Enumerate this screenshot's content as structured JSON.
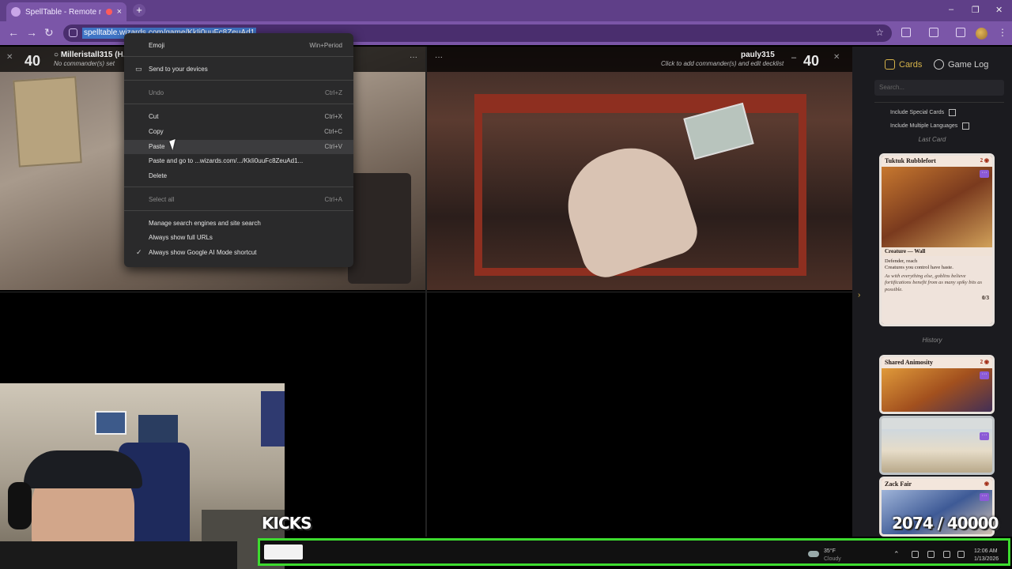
{
  "browser": {
    "tab_title": "SpellTable - Remote magic",
    "tab_close": "×",
    "new_tab": "+",
    "url": "spelltable.wizards.com/game/KkIi0uuFc8ZeuAd1",
    "window_controls": {
      "minimize": "–",
      "maximize": "❐",
      "close": "✕"
    },
    "back": "←",
    "forward": "→",
    "reload": "↻",
    "star": "☆",
    "kebab": "⋮"
  },
  "context_menu": {
    "items": [
      {
        "label": "Emoji",
        "shortcut": "Win+Period",
        "disabled": false
      },
      {
        "label": "Send to your devices",
        "shortcut": "",
        "disabled": false
      },
      {
        "label": "Undo",
        "shortcut": "Ctrl+Z",
        "disabled": true
      },
      {
        "label": "Cut",
        "shortcut": "Ctrl+X",
        "disabled": false
      },
      {
        "label": "Copy",
        "shortcut": "Ctrl+C",
        "disabled": false
      },
      {
        "label": "Paste",
        "shortcut": "Ctrl+V",
        "disabled": false
      },
      {
        "label": "Paste and go to ...wizards.com/.../KkIi0uuFc8ZeuAd1...",
        "shortcut": "",
        "disabled": false
      },
      {
        "label": "Delete",
        "shortcut": "",
        "disabled": false
      },
      {
        "label": "Select all",
        "shortcut": "Ctrl+A",
        "disabled": true
      },
      {
        "label": "Manage search engines and site search",
        "shortcut": "",
        "disabled": false
      },
      {
        "label": "Always show full URLs",
        "shortcut": "",
        "disabled": false
      },
      {
        "label": "Always show Google AI Mode shortcut",
        "shortcut": "",
        "disabled": false
      }
    ],
    "check_mark": "✓"
  },
  "players": {
    "p1": {
      "life": "40",
      "name": "Milleristall315",
      "name_suffix": "(H...",
      "sub": "No commander(s) set",
      "menu": "···"
    },
    "p2": {
      "life": "40",
      "name": "pauly315",
      "sub": "Click to add commander(s) and edit decklist",
      "minus": "–",
      "menu": "···"
    }
  },
  "panel": {
    "tab_cards": "Cards",
    "tab_log": "Game Log",
    "search_placeholder": "Search...",
    "include_special": "Include Special Cards",
    "include_multi_lang": "Include Multiple Languages",
    "last_card_label": "Last Card",
    "history_label": "History",
    "last_card": {
      "name": "Tuktuk Rubblefort",
      "mana": "2 ◉",
      "type": "Creature — Wall",
      "text1": "Defender, reach",
      "text2": "Creatures you control have haste.",
      "flavor": "As with everything else, goblins believe fortifications benefit from as many spiky bits as possible.",
      "pt": "0/3"
    },
    "history": [
      {
        "name": "Shared Animosity",
        "mana": "2 ◉"
      },
      {
        "name": "",
        "mana": ""
      },
      {
        "name": "Zack Fair",
        "mana": "◉"
      }
    ],
    "menu_glyph": "···",
    "arrow": "›"
  },
  "overlay": {
    "kicks_label": "KICKS",
    "count": "2074 / 40000",
    "progress": 0.052
  },
  "taskbar": {
    "temp": "35°F",
    "condition": "Cloudy",
    "time": "12:06 AM",
    "date": "1/13/2026",
    "tray_up": "⌃"
  },
  "colors": {
    "browser_frame": "#7b56a8",
    "progress_border": "#3ddc2f",
    "accent_gold": "#d6b34a",
    "selection": "#3f74c5"
  }
}
